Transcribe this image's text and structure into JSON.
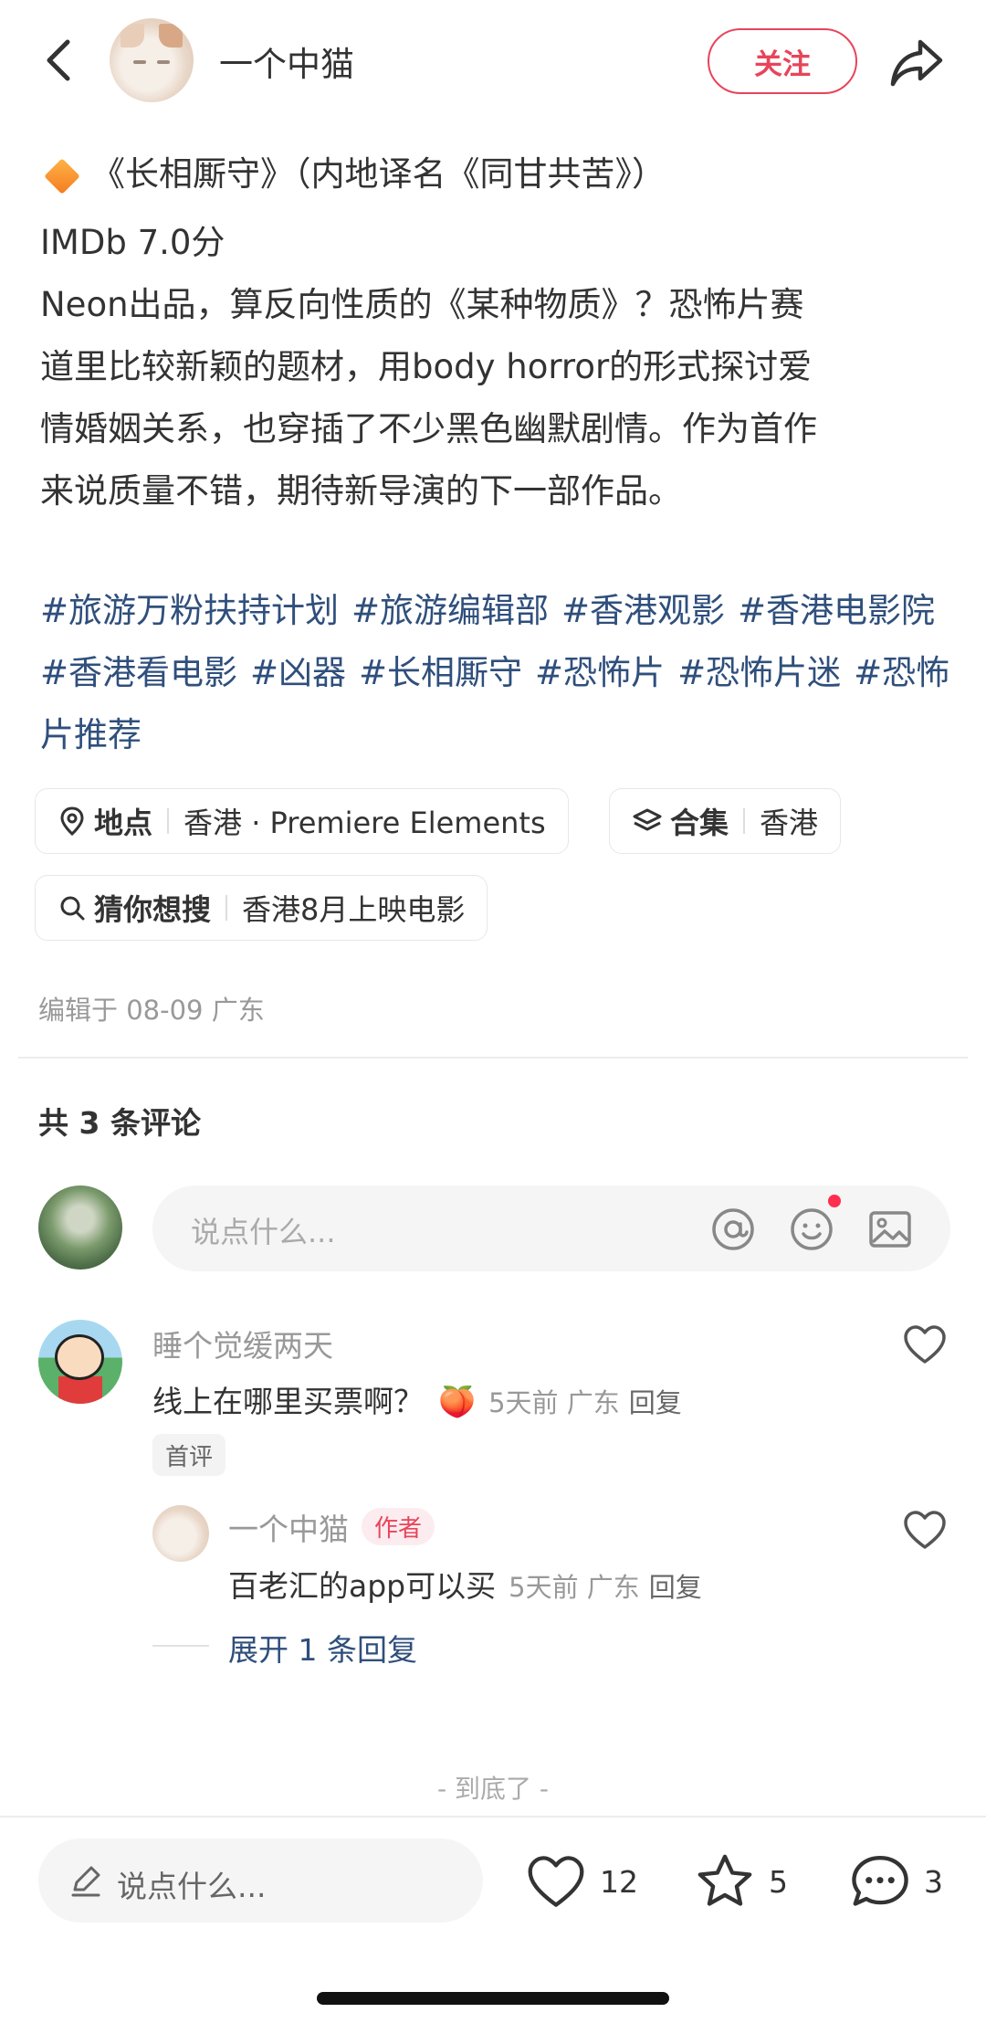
{
  "header": {
    "author_name": "一个中猫",
    "follow_label": "关注"
  },
  "post": {
    "title": "《长相厮守》（内地译名《同甘共苦》）",
    "lines": [
      "IMDb 7.0分",
      "Neon出品，算反向性质的《某种物质》？恐怖片赛",
      "道里比较新颖的题材，用body horror的形式探讨爱",
      "情婚姻关系，也穿插了不少黑色幽默剧情。作为首作",
      "来说质量不错，期待新导演的下一部作品。"
    ],
    "tags": [
      "#旅游万粉扶持计划",
      "#旅游编辑部",
      "#香港观影",
      "#香港电影院",
      "#香港看电影",
      "#凶器",
      "#长相厮守",
      "#恐怖片",
      "#恐怖片迷",
      "#恐怖片推荐"
    ]
  },
  "pills": {
    "location_key": "地点",
    "location_value": "香港 · Premiere Elements",
    "collection_key": "合集",
    "collection_value": "香港",
    "guess_key": "猜你想搜",
    "guess_value": "香港8月上映电影"
  },
  "edit_meta": "编辑于 08-09 广东",
  "comments_header": "共 3 条评论",
  "comment_input_placeholder": "说点什么...",
  "comments": [
    {
      "user": "睡个觉缓两天",
      "text": "线上在哪里买票啊？",
      "emoji": "🍑",
      "meta": "5天前 广东",
      "reply_label": "回复",
      "badge": "首评",
      "replies": [
        {
          "user": "一个中猫",
          "author_badge": "作者",
          "text": "百老汇的app可以买",
          "meta": "5天前 广东",
          "reply_label": "回复"
        }
      ],
      "expand_label": "展开 1 条回复"
    }
  ],
  "end_text": "- 到底了 -",
  "bottom_bar": {
    "input_placeholder": "说点什么...",
    "likes": "12",
    "collects": "5",
    "comments": "3"
  },
  "colors": {
    "accent_red": "#e8445a",
    "tag_blue": "#2f4f7c"
  }
}
